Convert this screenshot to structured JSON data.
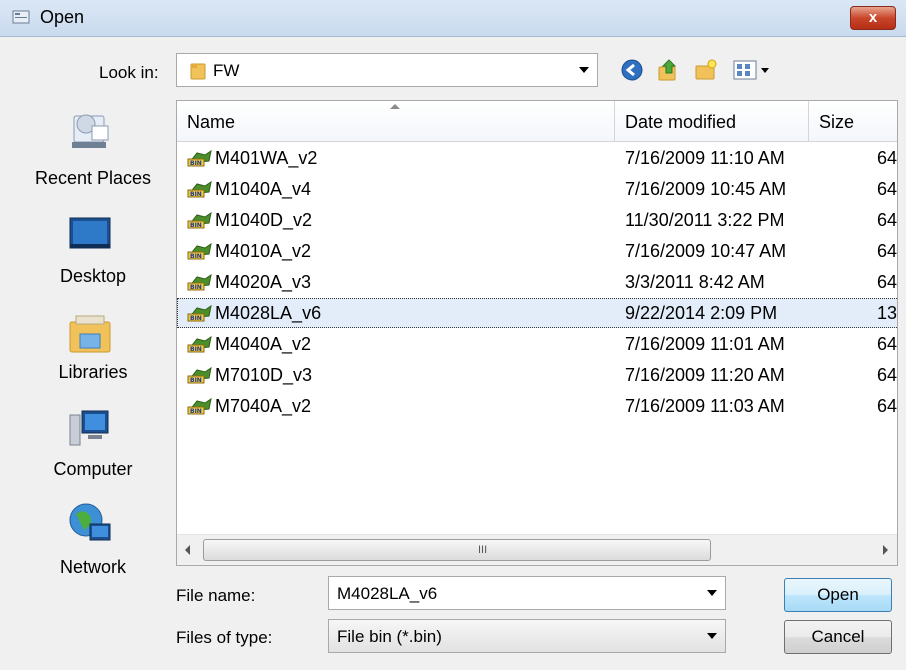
{
  "window": {
    "title": "Open",
    "close_label": "x"
  },
  "lookin": {
    "label": "Look in:",
    "value": "FW"
  },
  "toolbar": {
    "icons": [
      "back-icon",
      "up-folder-icon",
      "new-folder-icon",
      "views-menu-icon"
    ]
  },
  "places": [
    {
      "label": "Recent Places",
      "icon": "recent-places-icon"
    },
    {
      "label": "Desktop",
      "icon": "desktop-icon"
    },
    {
      "label": "Libraries",
      "icon": "libraries-icon"
    },
    {
      "label": "Computer",
      "icon": "computer-icon"
    },
    {
      "label": "Network",
      "icon": "network-icon"
    }
  ],
  "columns": {
    "name": "Name",
    "date": "Date modified",
    "size": "Size"
  },
  "files": [
    {
      "name": "M401WA_v2",
      "date": "7/16/2009 11:10 AM",
      "size": "64"
    },
    {
      "name": "M1040A_v4",
      "date": "7/16/2009 10:45 AM",
      "size": "64"
    },
    {
      "name": "M1040D_v2",
      "date": "11/30/2011 3:22 PM",
      "size": "64"
    },
    {
      "name": "M4010A_v2",
      "date": "7/16/2009 10:47 AM",
      "size": "64"
    },
    {
      "name": "M4020A_v3",
      "date": "3/3/2011 8:42 AM",
      "size": "64"
    },
    {
      "name": "M4028LA_v6",
      "date": "9/22/2014 2:09 PM",
      "size": "13",
      "selected": true
    },
    {
      "name": "M4040A_v2",
      "date": "7/16/2009 11:01 AM",
      "size": "64"
    },
    {
      "name": "M7010D_v3",
      "date": "7/16/2009 11:20 AM",
      "size": "64"
    },
    {
      "name": "M7040A_v2",
      "date": "7/16/2009 11:03 AM",
      "size": "64"
    }
  ],
  "scrollbar": {
    "grip": "III"
  },
  "filename": {
    "label": "File name:",
    "value": "M4028LA_v6"
  },
  "filetype": {
    "label": "Files of type:",
    "value": "File bin (*.bin)"
  },
  "buttons": {
    "open": "Open",
    "cancel": "Cancel"
  }
}
